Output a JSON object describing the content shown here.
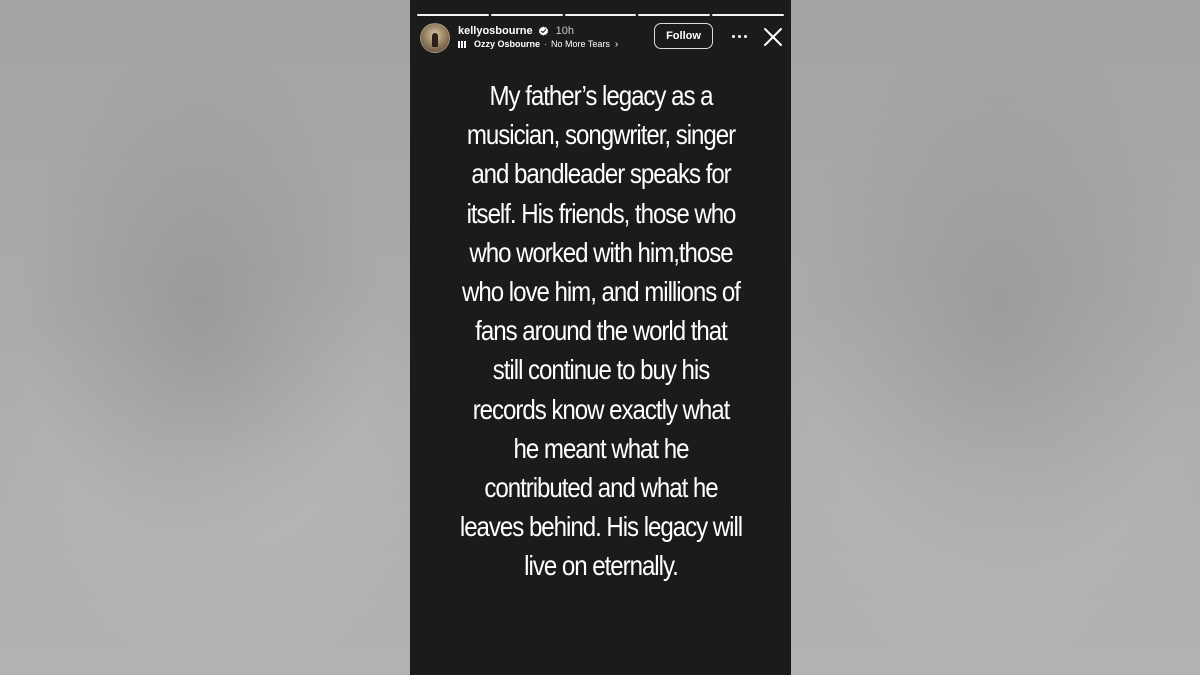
{
  "story": {
    "username": "kellyosbourne",
    "verified": true,
    "timestamp": "10h",
    "music": {
      "artist": "Ozzy Osbourne",
      "separator": "·",
      "song": "No More Tears",
      "chevron": "›"
    },
    "follow_label": "Follow",
    "progress": {
      "segments_total": 5,
      "segments_viewed": 5
    },
    "text_lines": [
      "My father’s legacy as a",
      "musician, songwriter, singer",
      "and bandleader speaks for",
      "itself. His friends, those who",
      "who worked with him,those",
      "who love him, and millions of",
      "fans around the world that",
      "still continue to buy his",
      "records know exactly what",
      "he meant what he",
      "contributed and what he",
      "leaves behind. His legacy will",
      "live on eternally."
    ],
    "icons": {
      "verified": "verified-badge-icon",
      "music": "music-bars-icon",
      "more": "more-options-icon",
      "close": "close-icon"
    },
    "colors": {
      "story_background": "#1b1b1b",
      "text": "#ffffff",
      "backdrop": "#a9a9a9"
    }
  }
}
